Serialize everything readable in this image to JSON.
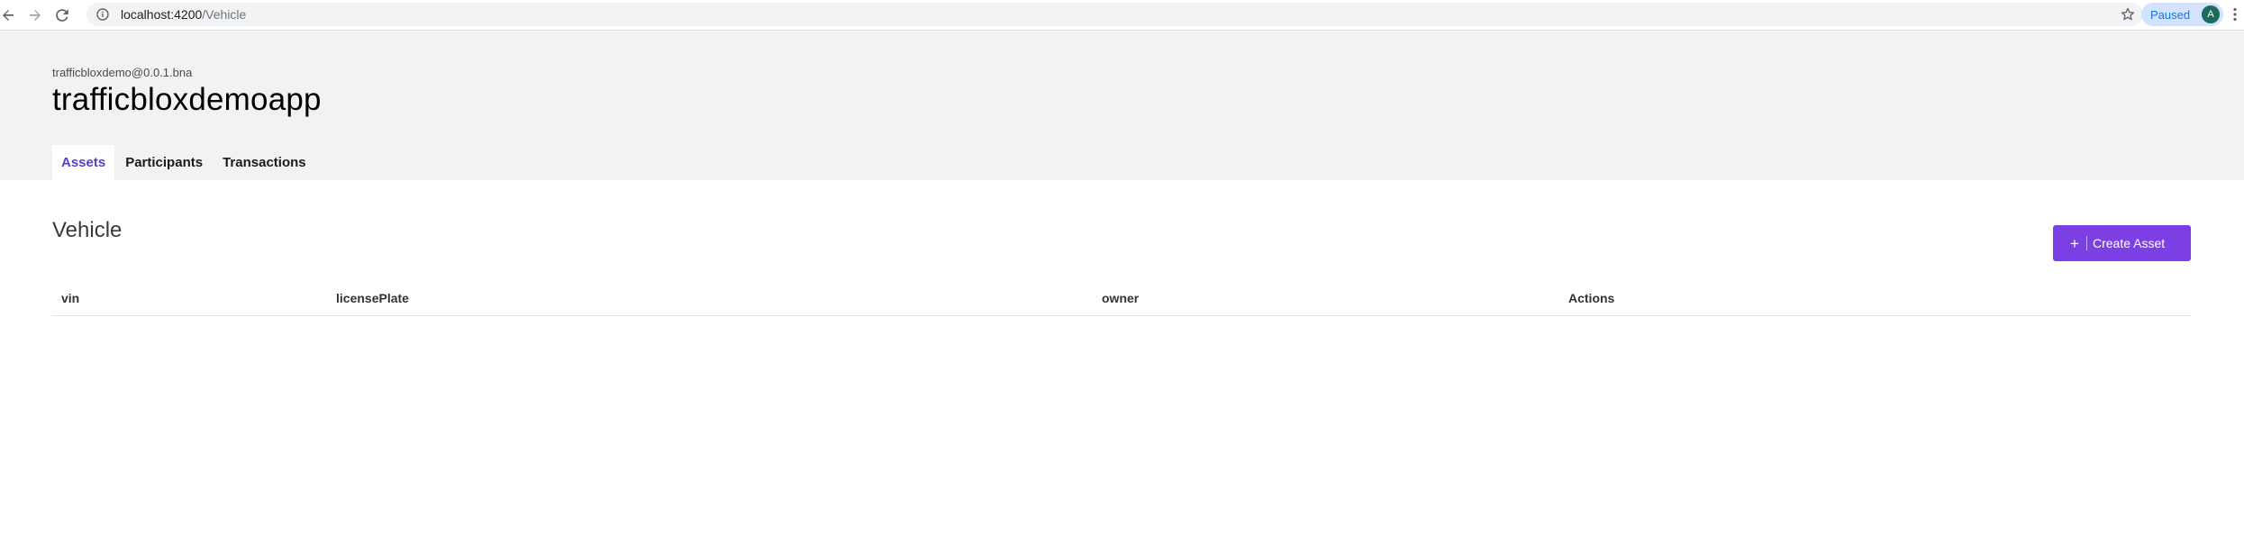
{
  "browser": {
    "url_host": "localhost:4200",
    "url_path": "/Vehicle",
    "profile_status": "Paused",
    "avatar_initial": "A",
    "icons": {
      "back": "arrow-left-icon",
      "forward": "arrow-right-icon",
      "reload": "reload-icon",
      "site_info": "info-icon",
      "bookmark": "star-icon",
      "menu": "vertical-dots-icon"
    }
  },
  "app": {
    "subtitle": "trafficbloxdemo@0.0.1.bna",
    "title": "trafficbloxdemoapp"
  },
  "tabs": [
    {
      "label": "Assets",
      "active": true
    },
    {
      "label": "Participants",
      "active": false
    },
    {
      "label": "Transactions",
      "active": false
    }
  ],
  "main": {
    "heading": "Vehicle",
    "create_button_label": "Create Asset",
    "create_button_icon": "plus-icon",
    "table": {
      "columns": [
        "vin",
        "licensePlate",
        "owner",
        "Actions"
      ],
      "rows": []
    }
  },
  "colors": {
    "accent": "#7b3fe4",
    "active_tab_text": "#5b3fc2",
    "header_bg": "#f2f2f2",
    "avatar_bg": "#1e6b5c",
    "profile_pill_bg": "#d3e3fd"
  }
}
